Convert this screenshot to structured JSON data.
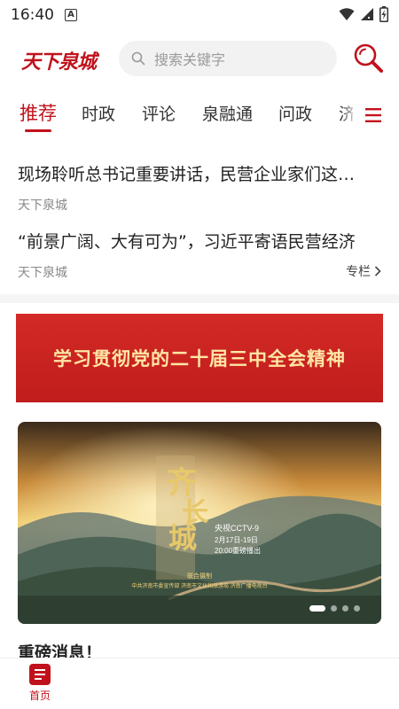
{
  "status_bar": {
    "time": "16:40",
    "notification_icon": "A"
  },
  "header": {
    "logo_text": "天下泉城",
    "search_placeholder": "搜索关键字",
    "brand_color": "#c1121c"
  },
  "tabs": {
    "items": [
      {
        "label": "推荐",
        "active": true
      },
      {
        "label": "时政",
        "active": false
      },
      {
        "label": "评论",
        "active": false
      },
      {
        "label": "泉融通",
        "active": false
      },
      {
        "label": "问政",
        "active": false
      },
      {
        "label": "济",
        "active": false
      }
    ],
    "menu_icon": "hamburger-menu-icon"
  },
  "news": [
    {
      "title": "现场聆听总书记重要讲话，民营企业家们这…",
      "source": "天下泉城"
    },
    {
      "title": "“前景广阔、大有可为”，习近平寄语民营经济",
      "source": "天下泉城"
    }
  ],
  "special_link": "专栏",
  "banner": {
    "text": "学习贯彻党的二十届三中全会精神",
    "color": "#c8201e",
    "text_color": "#ffe6a4"
  },
  "carousel": {
    "title_art": "齐长城",
    "channel": "央视CCTV-9",
    "date": "2月17日-19日",
    "time": "20:00重磅播出",
    "produced": "联合摄制",
    "credits": "中共济南市委宣传部  济南市文化和旅游局  济南广播电视台",
    "slide_count": 4,
    "active_slide": 1
  },
  "section_heading": "重磅消息！",
  "bottom_nav": {
    "home_label": "首页"
  }
}
